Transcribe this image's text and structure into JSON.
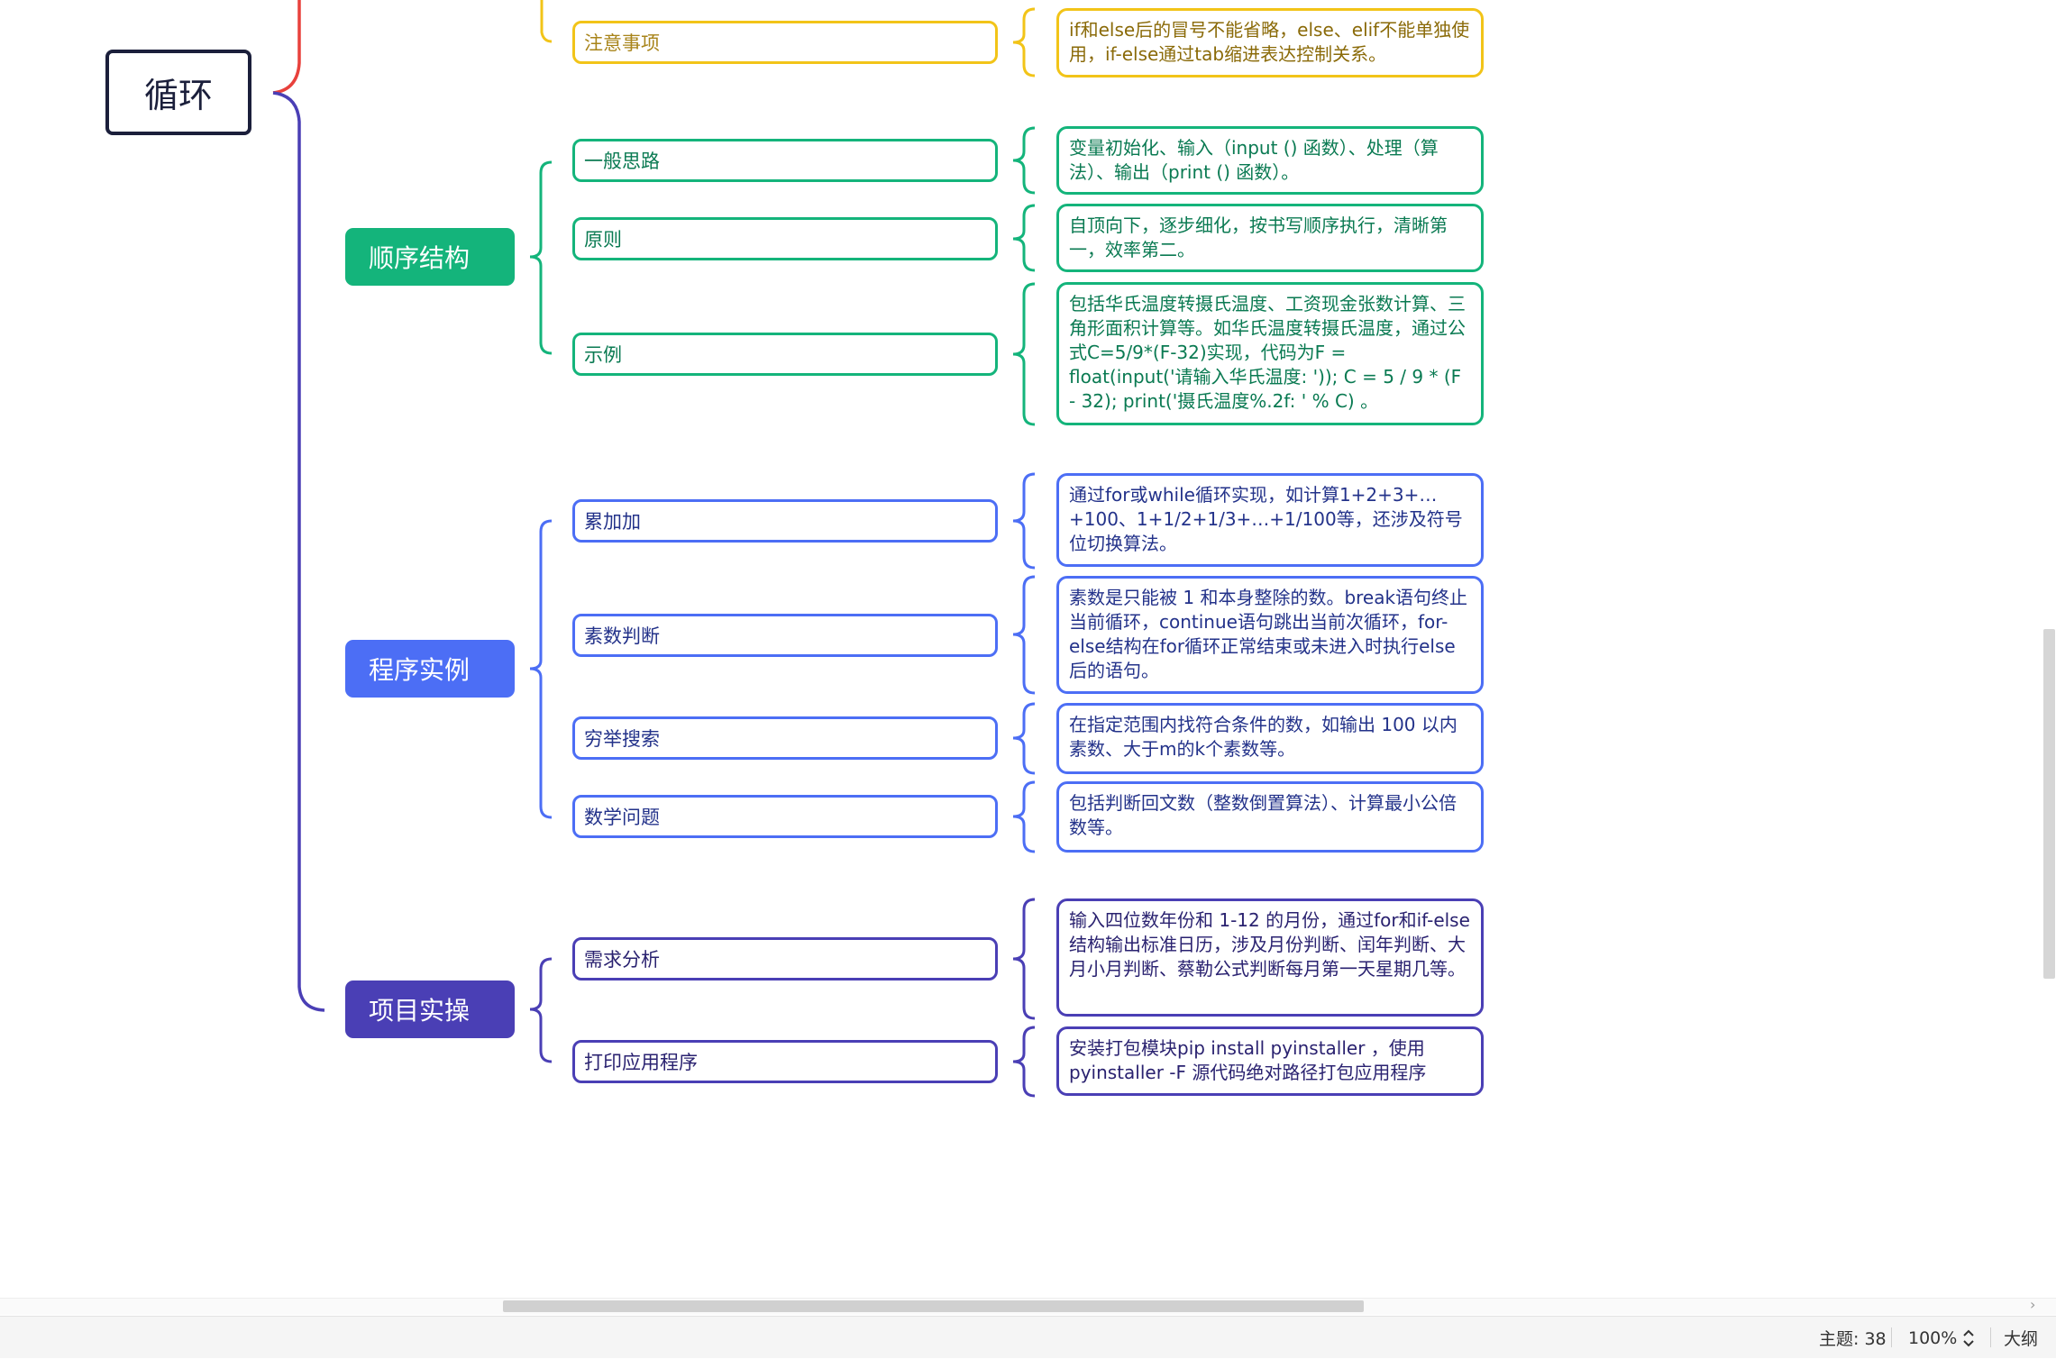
{
  "mindmap": {
    "root": {
      "label": "循环"
    },
    "branches": [
      {
        "label": "顺序结构",
        "color": "#14b47b"
      },
      {
        "label": "程序实例",
        "color": "#4c6ef5"
      },
      {
        "label": "项目实操",
        "color": "#4a3fb5"
      }
    ],
    "topics": [
      {
        "label": "注意事项",
        "note": "if和else后的冒号不能省略，else、elif不能单独使用，if-else通过tab缩进表达控制关系。"
      },
      {
        "label": "一般思路",
        "note": "变量初始化、输入（input () 函数）、处理（算法）、输出（print () 函数）。"
      },
      {
        "label": "原则",
        "note": "自顶向下，逐步细化，按书写顺序执行，清晰第一，效率第二。"
      },
      {
        "label": "示例",
        "note": "包括华氏温度转摄氏温度、工资现金张数计算、三角形面积计算等。如华氏温度转摄氏温度，通过公式C=5/9*(F-32)实现，代码为F = float(input('请输入华氏温度: ')); C = 5 / 9 * (F - 32); print('摄氏温度%.2f: ' % C) 。"
      },
      {
        "label": "累加加",
        "note": "通过for或while循环实现，如计算1+2+3+…+100、1+1/2+1/3+…+1/100等，还涉及符号位切换算法。"
      },
      {
        "label": "素数判断",
        "note": "素数是只能被 1 和本身整除的数。break语句终止当前循环，continue语句跳出当前次循环，for-else结构在for循环正常结束或未进入时执行else后的语句。"
      },
      {
        "label": "穷举搜索",
        "note": "在指定范围内找符合条件的数，如输出 100 以内素数、大于m的k个素数等。"
      },
      {
        "label": "数学问题",
        "note": "包括判断回文数（整数倒置算法）、计算最小公倍数等。"
      },
      {
        "label": "需求分析",
        "note": "输入四位数年份和 1-12 的月份，通过for和if-else结构输出标准日历，涉及月份判断、闰年判断、大月小月判断、蔡勒公式判断每月第一天星期几等。"
      },
      {
        "label": "打印应用程序",
        "note": "安装打包模块pip install pyinstaller ，使用pyinstaller -F 源代码绝对路径打包应用程序"
      }
    ]
  },
  "statusbar": {
    "topic_count": "主题: 38",
    "zoom": "100%",
    "outline": "大纲"
  },
  "colors": {
    "yellow": "#f2c418",
    "green": "#14b47b",
    "blue": "#4c6ef5",
    "purple": "#4a3fb5",
    "red": "#e8413c"
  }
}
